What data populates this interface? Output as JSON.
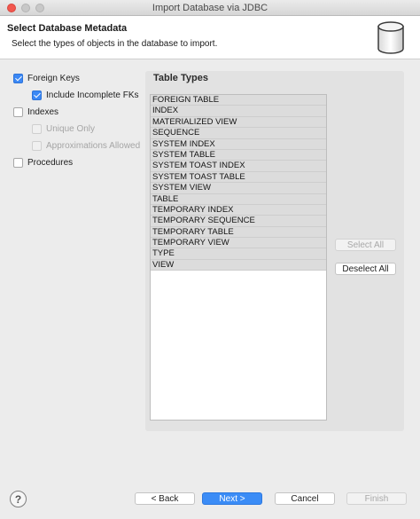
{
  "window": {
    "title": "Import Database via JDBC"
  },
  "banner": {
    "title": "Select Database Metadata",
    "description": "Select the types of objects in the database to import."
  },
  "options": {
    "foreign_keys": {
      "label": "Foreign Keys",
      "checked": true
    },
    "include_incomplete_fks": {
      "label": "Include Incomplete FKs",
      "checked": true
    },
    "indexes": {
      "label": "Indexes",
      "checked": false
    },
    "unique_only": {
      "label": "Unique Only",
      "checked": false,
      "enabled": false
    },
    "approximations_allowed": {
      "label": "Approximations Allowed",
      "checked": false,
      "enabled": false
    },
    "procedures": {
      "label": "Procedures",
      "checked": false
    }
  },
  "table_types": {
    "label": "Table Types",
    "items": [
      "FOREIGN TABLE",
      "INDEX",
      "MATERIALIZED VIEW",
      "SEQUENCE",
      "SYSTEM INDEX",
      "SYSTEM TABLE",
      "SYSTEM TOAST INDEX",
      "SYSTEM TOAST TABLE",
      "SYSTEM VIEW",
      "TABLE",
      "TEMPORARY INDEX",
      "TEMPORARY SEQUENCE",
      "TEMPORARY TABLE",
      "TEMPORARY VIEW",
      "TYPE",
      "VIEW"
    ],
    "select_all_label": "Select All",
    "deselect_all_label": "Deselect All"
  },
  "footer": {
    "help_glyph": "?",
    "back_label": "< Back",
    "next_label": "Next >",
    "cancel_label": "Cancel",
    "finish_label": "Finish"
  },
  "colors": {
    "accent": "#3b8cf6",
    "close": "#f2574e"
  },
  "icons": {
    "banner": "database-icon",
    "help": "help-icon"
  }
}
